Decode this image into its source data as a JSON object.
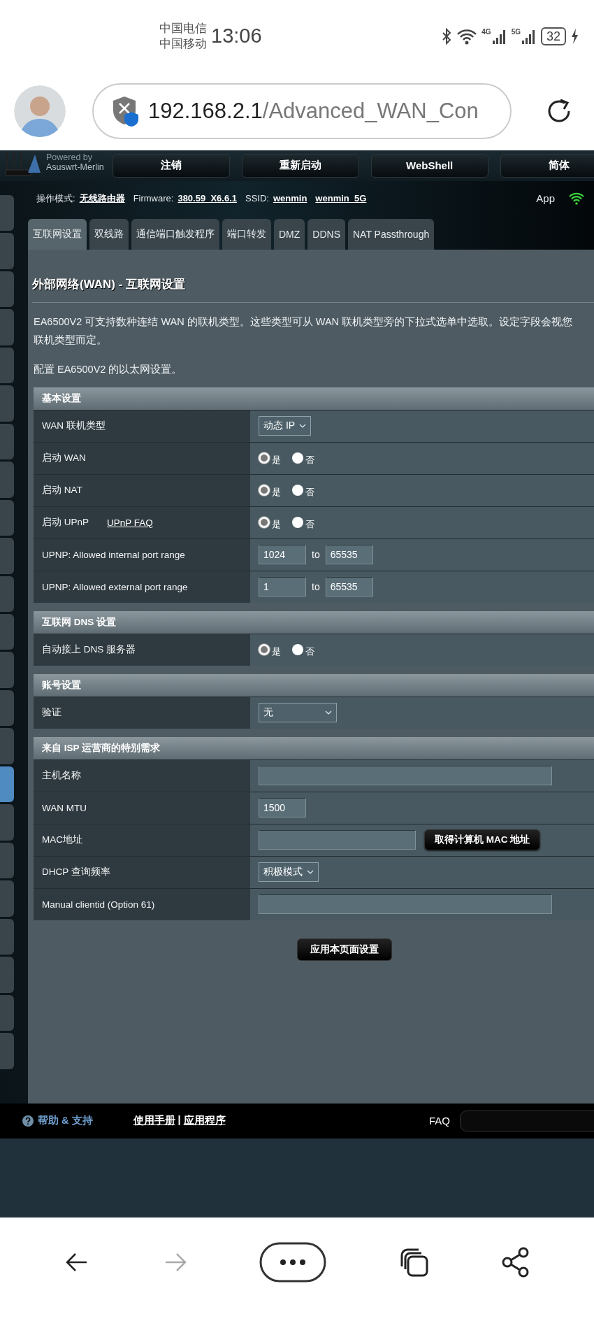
{
  "status_bar": {
    "carriers": [
      "中国电信",
      "中国移动"
    ],
    "time": "13:06",
    "net_labels": [
      "4G",
      "5G"
    ],
    "battery": "32"
  },
  "browser": {
    "url_host": "192.168.2.1",
    "url_path": "/Advanced_WAN_Con"
  },
  "router": {
    "logo_lines": [
      "Powered by",
      "Asuswrt-Merlin"
    ],
    "header_buttons": [
      "注销",
      "重新启动",
      "WebShell",
      "简体"
    ],
    "info": [
      {
        "kind": "label",
        "text": "操作模式:"
      },
      {
        "kind": "link",
        "text": "无线路由器"
      },
      {
        "kind": "label",
        "text": "Firmware:"
      },
      {
        "kind": "link",
        "text": "380.59_X6.6.1"
      },
      {
        "kind": "label",
        "text": "SSID:"
      },
      {
        "kind": "link",
        "text": "wenmin"
      },
      {
        "kind": "link",
        "text": "wenmin_5G"
      }
    ],
    "app_label": "App",
    "tabs": [
      {
        "label": "互联网设置",
        "selected": true
      },
      {
        "label": "双线路",
        "selected": false
      },
      {
        "label": "通信端口触发程序",
        "selected": false
      },
      {
        "label": "端口转发",
        "selected": false
      },
      {
        "label": "DMZ",
        "selected": false
      },
      {
        "label": "DDNS",
        "selected": false
      },
      {
        "label": "NAT Passthrough",
        "selected": false
      }
    ],
    "title": "外部网络(WAN) - 互联网设置",
    "description_lines": [
      "EA6500V2 可支持数种连结 WAN 的联机类型。这些类型可从 WAN 联机类型旁的下拉式选单中选取。设定字段会视您",
      "联机类型而定。"
    ],
    "config_note": "配置 EA6500V2 的以太网设置。",
    "sections": [
      {
        "title": "基本设置",
        "rows": [
          {
            "kind": "select",
            "label": "WAN 联机类型",
            "value": "动态 IP"
          },
          {
            "kind": "radio",
            "label": "启动 WAN",
            "options": [
              {
                "label": "是",
                "selected": true
              },
              {
                "label": "否",
                "selected": false
              }
            ]
          },
          {
            "kind": "radio",
            "label": "启动 NAT",
            "options": [
              {
                "label": "是",
                "selected": true
              },
              {
                "label": "否",
                "selected": false
              }
            ]
          },
          {
            "kind": "radio",
            "label": "启动 UPnP",
            "link": "UPnP FAQ",
            "options": [
              {
                "label": "是",
                "selected": true
              },
              {
                "label": "否",
                "selected": false
              }
            ]
          },
          {
            "kind": "range",
            "label": "UPNP: Allowed internal port range",
            "from": "1024",
            "joiner": "to",
            "to": "65535"
          },
          {
            "kind": "range",
            "label": "UPNP: Allowed external port range",
            "from": "1",
            "joiner": "to",
            "to": "65535"
          }
        ]
      },
      {
        "title": "互联网 DNS 设置",
        "rows": [
          {
            "kind": "radio",
            "label": "自动接上 DNS 服务器",
            "options": [
              {
                "label": "是",
                "selected": true
              },
              {
                "label": "否",
                "selected": false
              }
            ]
          }
        ]
      },
      {
        "title": "账号设置",
        "rows": [
          {
            "kind": "dropdown",
            "label": "验证",
            "value": "无"
          }
        ]
      },
      {
        "title": "来自 ISP 运营商的特别需求",
        "rows": [
          {
            "kind": "wide_input",
            "label": "主机名称"
          },
          {
            "kind": "short_input",
            "label": "WAN MTU",
            "value": "1500"
          },
          {
            "kind": "input_button",
            "label": "MAC地址",
            "button": "取得计算机 MAC 地址"
          },
          {
            "kind": "select",
            "label": "DHCP 查询频率",
            "value": "积极模式"
          },
          {
            "kind": "wide_input",
            "label": "Manual clientid (Option 61)"
          }
        ]
      }
    ],
    "apply_button": "应用本页面设置",
    "footer": {
      "help": "帮助 & 支持",
      "links": [
        "使用手册",
        "应用程序"
      ],
      "separator": "|",
      "faq": "FAQ"
    }
  }
}
